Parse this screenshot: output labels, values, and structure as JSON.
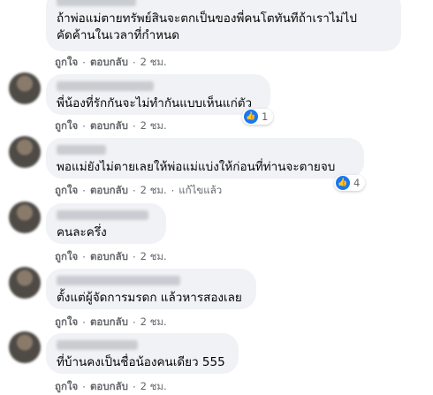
{
  "actions": {
    "like": "ถูกใจ",
    "reply": "ตอบกลับ",
    "separator": "·"
  },
  "colors": {
    "like_blue": "#1877f2",
    "bubble": "#f0f2f5",
    "meta": "#65676b"
  },
  "comments": [
    {
      "text": "ถ้าพ่อแม่ตายทรัพย์สินจะตกเป็นของพี่คนโตทันทีถ้าเราไม่ไป\nคัดค้านในเวลาที่กำหนด",
      "time": "2 ชม."
    },
    {
      "text": "พี่น้องที่รักกันจะไม่ทำกันแบบเห็นแก่ตัว",
      "time": "2 ชม.",
      "reactions": "1",
      "reaction_icon": "like-icon"
    },
    {
      "text": "พอแม่ยังไม่ตายเลยให้พ่อแม่แบ่งให้ก่อนที่ท่านจะตายจบ",
      "time": "2 ชม.",
      "edited": "แก้ไขแล้ว",
      "reactions": "4",
      "reaction_icon": "like-icon"
    },
    {
      "text": "คนละครึ่ง",
      "time": "2 ชม."
    },
    {
      "text": "ตั้งแต่ผู้จัดการมรดก แล้วหารสองเลย",
      "time": "2 ชม."
    },
    {
      "text": "ที่บ้านคงเป็นชื่อน้องคนเดียว 555",
      "time": "2 ชม."
    }
  ]
}
